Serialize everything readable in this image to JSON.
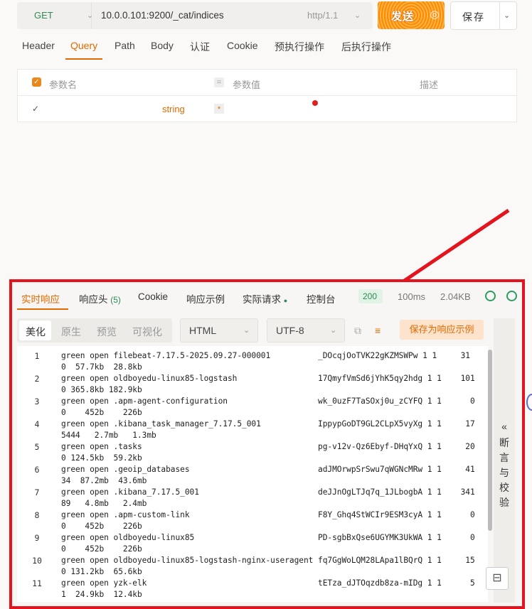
{
  "request": {
    "method": "GET",
    "url": "10.0.0.101:9200/_cat/indices",
    "protocol": "http/1.1",
    "send_label": "发送",
    "save_label": "保存"
  },
  "request_tabs": [
    "Header",
    "Query",
    "Path",
    "Body",
    "认证",
    "Cookie",
    "预执行操作",
    "后执行操作"
  ],
  "active_request_tab": "Query",
  "params": {
    "headers": {
      "name": "参数名",
      "value": "参数值",
      "desc": "描述"
    },
    "row": {
      "type": "string",
      "required_mark": "*"
    }
  },
  "response": {
    "tabs": {
      "realtime": "实时响应",
      "headers": "响应头",
      "headers_count": "(5)",
      "cookie": "Cookie",
      "example": "响应示例",
      "actual": "实际请求",
      "console": "控制台"
    },
    "status": "200",
    "time": "100ms",
    "size": "2.04KB",
    "format_tabs": [
      "美化",
      "原生",
      "预览",
      "可视化"
    ],
    "active_format": "美化",
    "content_type": "HTML",
    "encoding": "UTF-8",
    "save_example": "保存为响应示例",
    "side_label": [
      "«",
      "断",
      "言",
      "与",
      "校",
      "验"
    ],
    "lines": [
      {
        "n": "1",
        "a": "green open filebeat-7.17.5-2025.09.27-000001          _DOcqjOoTVK22gKZMSWPw 1 1     31",
        "b": "0  57.7kb  28.8kb"
      },
      {
        "n": "2",
        "a": "green open oldboyedu-linux85-logstash                 17QmyfVmSd6jYhK5qy2hdg 1 1    101",
        "b": "0 365.8kb 182.9kb"
      },
      {
        "n": "3",
        "a": "green open .apm-agent-configuration                   wk_0uzF7TaSOxj0u_zCYFQ 1 1      0",
        "b": "0    452b    226b"
      },
      {
        "n": "4",
        "a": "green open .kibana_task_manager_7.17.5_001            IppypGoDT9GL2CLpX5vyXg 1 1     17",
        "b": "5444   2.7mb   1.3mb"
      },
      {
        "n": "5",
        "a": "green open .tasks                                     pg-v12v-Qz6Ebyf-DHqYxQ 1 1     20",
        "b": "0 124.5kb  59.2kb"
      },
      {
        "n": "6",
        "a": "green open .geoip_databases                           adJMOrwpSrSwu7qWGNcMRw 1 1     41",
        "b": "34  87.2mb  43.6mb"
      },
      {
        "n": "7",
        "a": "green open .kibana_7.17.5_001                         deJJnOgLTJq7q_1JLbogbA 1 1    341",
        "b": "89   4.8mb   2.4mb"
      },
      {
        "n": "8",
        "a": "green open .apm-custom-link                           F8Y_Ghq4StWCIr9ESM3cyA 1 1      0",
        "b": "0    452b    226b"
      },
      {
        "n": "9",
        "a": "green open oldboyedu-linux85                          PD-sgbBxQse6UGYMK3UkWA 1 1      0",
        "b": "0    452b    226b"
      },
      {
        "n": "10",
        "a": "green open oldboyedu-linux85-logstash-nginx-useragent fq7GgWoLQM28LApa1lBQrQ 1 1     15",
        "b": "0 131.2kb  65.6kb"
      },
      {
        "n": "11",
        "a": "green open yzk-elk                                    tETza_dJTOqzdb8za-mIDg 1 1      5",
        "b": "1  24.9kb  12.4kb"
      }
    ]
  },
  "colors": {
    "accent": "#e26a00",
    "highlight_border": "#e4141f",
    "success": "#2e8b57"
  }
}
